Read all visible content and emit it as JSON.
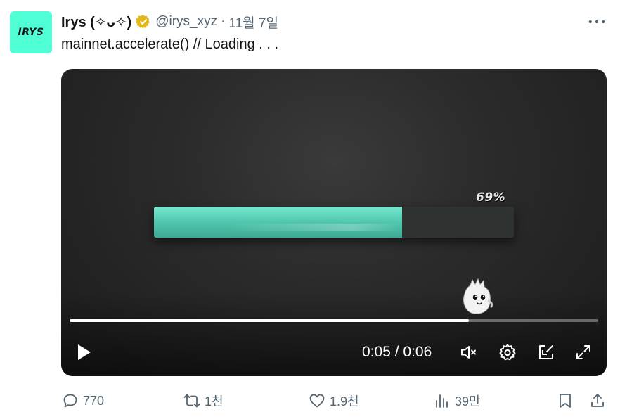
{
  "author": {
    "avatar_text": "IRYS",
    "display_name": "Irys (✧ᴗ✧)",
    "handle": "@irys_xyz",
    "separator": "·",
    "date": "11월 7일"
  },
  "tweet": {
    "text": "mainnet.accelerate() // Loading . . ."
  },
  "video": {
    "loading_label": "69%",
    "loading_progress": 0.69,
    "playback_progress": 0.755,
    "time": {
      "current": "0:05",
      "separator": " / ",
      "total": "0:06"
    }
  },
  "actions": {
    "reply_count": "770",
    "retweet_count": "1천",
    "like_count": "1.9천",
    "view_count": "39만"
  },
  "colors": {
    "accent_mint": "#51ffd6",
    "verified_gold": "#e2b719",
    "muted": "#536471",
    "text": "#0f1419"
  },
  "icons": {
    "verified": "verified-badge-icon",
    "more": "more-horizontal-icon",
    "play": "play-icon",
    "mute": "volume-muted-icon",
    "settings": "gear-icon",
    "pip": "picture-in-picture-icon",
    "fullscreen": "fullscreen-expand-icon",
    "reply": "reply-bubble-icon",
    "retweet": "retweet-icon",
    "like": "heart-icon",
    "views": "views-bar-chart-icon",
    "bookmark": "bookmark-icon",
    "share": "share-upload-icon"
  }
}
